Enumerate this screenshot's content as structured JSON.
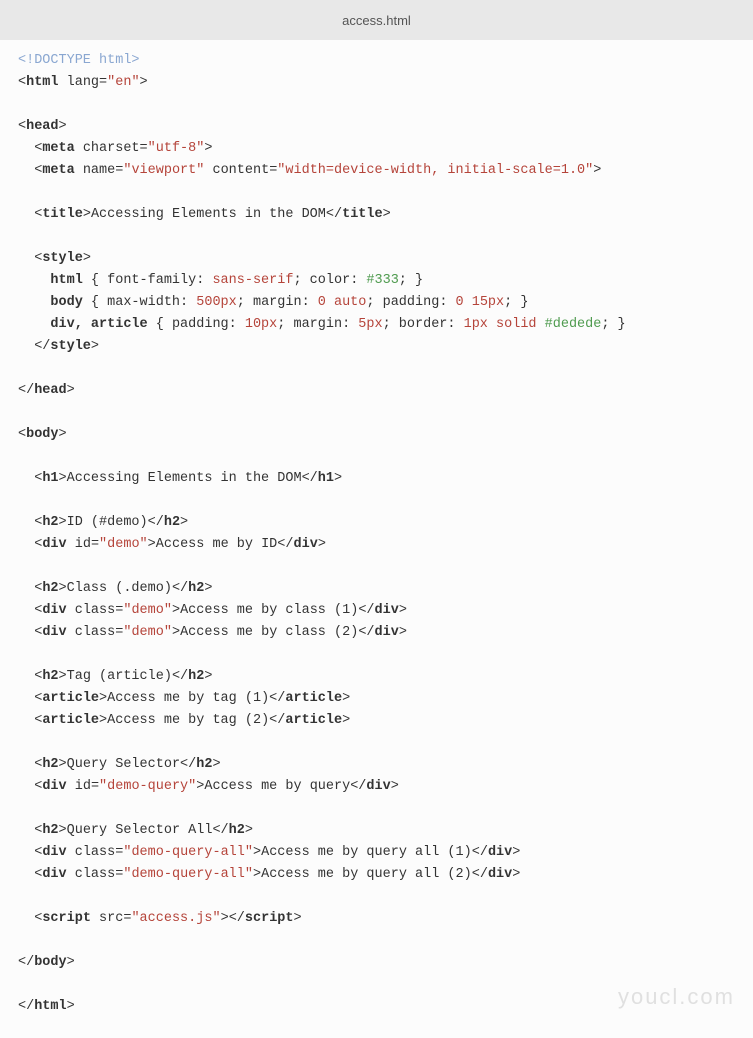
{
  "tab": {
    "title": "access.html"
  },
  "watermark": "youcl.com",
  "code": {
    "doctype": "<!DOCTYPE html>",
    "lines": [
      {
        "type": "open",
        "tag": "html",
        "attrs": [
          [
            "lang",
            "\"en\""
          ]
        ],
        "indent": 0
      },
      {
        "type": "blank"
      },
      {
        "type": "open",
        "tag": "head",
        "indent": 0
      },
      {
        "type": "selfclose",
        "tag": "meta",
        "attrs": [
          [
            "charset",
            "\"utf-8\""
          ]
        ],
        "indent": 1
      },
      {
        "type": "selfclose",
        "tag": "meta",
        "attrs": [
          [
            "name",
            "\"viewport\""
          ],
          [
            "content",
            "\"width=device-width, initial-scale=1.0\""
          ]
        ],
        "indent": 1
      },
      {
        "type": "blank"
      },
      {
        "type": "inline",
        "tag": "title",
        "text": "Accessing Elements in the DOM",
        "indent": 1
      },
      {
        "type": "blank"
      },
      {
        "type": "open",
        "tag": "style",
        "indent": 1
      },
      {
        "type": "css",
        "selector": "html",
        "rules": [
          [
            "font-family",
            "sans-serif",
            "val"
          ],
          [
            "color",
            "#333",
            "color"
          ]
        ],
        "indent": 2
      },
      {
        "type": "css",
        "selector": "body",
        "rules": [
          [
            "max-width",
            "500px",
            "num"
          ],
          [
            "margin",
            "0 auto",
            "num"
          ],
          [
            "padding",
            "0 15px",
            "num"
          ]
        ],
        "indent": 2
      },
      {
        "type": "css",
        "selector": "div, article",
        "rules": [
          [
            "padding",
            "10px",
            "num"
          ],
          [
            "margin",
            "5px",
            "num"
          ],
          [
            "border",
            "1px solid #dedede",
            "border"
          ]
        ],
        "indent": 2
      },
      {
        "type": "close",
        "tag": "style",
        "indent": 1
      },
      {
        "type": "blank"
      },
      {
        "type": "close",
        "tag": "head",
        "indent": 0
      },
      {
        "type": "blank"
      },
      {
        "type": "open",
        "tag": "body",
        "indent": 0
      },
      {
        "type": "blank"
      },
      {
        "type": "inline",
        "tag": "h1",
        "text": "Accessing Elements in the DOM",
        "indent": 1
      },
      {
        "type": "blank"
      },
      {
        "type": "inline",
        "tag": "h2",
        "text": "ID (#demo)",
        "indent": 1
      },
      {
        "type": "inline",
        "tag": "div",
        "attrs": [
          [
            "id",
            "\"demo\""
          ]
        ],
        "text": "Access me by ID",
        "indent": 1
      },
      {
        "type": "blank"
      },
      {
        "type": "inline",
        "tag": "h2",
        "text": "Class (.demo)",
        "indent": 1
      },
      {
        "type": "inline",
        "tag": "div",
        "attrs": [
          [
            "class",
            "\"demo\""
          ]
        ],
        "text": "Access me by class (1)",
        "indent": 1
      },
      {
        "type": "inline",
        "tag": "div",
        "attrs": [
          [
            "class",
            "\"demo\""
          ]
        ],
        "text": "Access me by class (2)",
        "indent": 1
      },
      {
        "type": "blank"
      },
      {
        "type": "inline",
        "tag": "h2",
        "text": "Tag (article)",
        "indent": 1
      },
      {
        "type": "inline",
        "tag": "article",
        "text": "Access me by tag (1)",
        "indent": 1
      },
      {
        "type": "inline",
        "tag": "article",
        "text": "Access me by tag (2)",
        "indent": 1
      },
      {
        "type": "blank"
      },
      {
        "type": "inline",
        "tag": "h2",
        "text": "Query Selector",
        "indent": 1
      },
      {
        "type": "inline",
        "tag": "div",
        "attrs": [
          [
            "id",
            "\"demo-query\""
          ]
        ],
        "text": "Access me by query",
        "indent": 1
      },
      {
        "type": "blank"
      },
      {
        "type": "inline",
        "tag": "h2",
        "text": "Query Selector All",
        "indent": 1
      },
      {
        "type": "inline",
        "tag": "div",
        "attrs": [
          [
            "class",
            "\"demo-query-all\""
          ]
        ],
        "text": "Access me by query all (1)",
        "indent": 1
      },
      {
        "type": "inline",
        "tag": "div",
        "attrs": [
          [
            "class",
            "\"demo-query-all\""
          ]
        ],
        "text": "Access me by query all (2)",
        "indent": 1
      },
      {
        "type": "blank"
      },
      {
        "type": "script",
        "attrs": [
          [
            "src",
            "\"access.js\""
          ]
        ],
        "indent": 1
      },
      {
        "type": "blank"
      },
      {
        "type": "close",
        "tag": "body",
        "indent": 0
      },
      {
        "type": "blank"
      },
      {
        "type": "close",
        "tag": "html",
        "indent": 0
      }
    ]
  }
}
